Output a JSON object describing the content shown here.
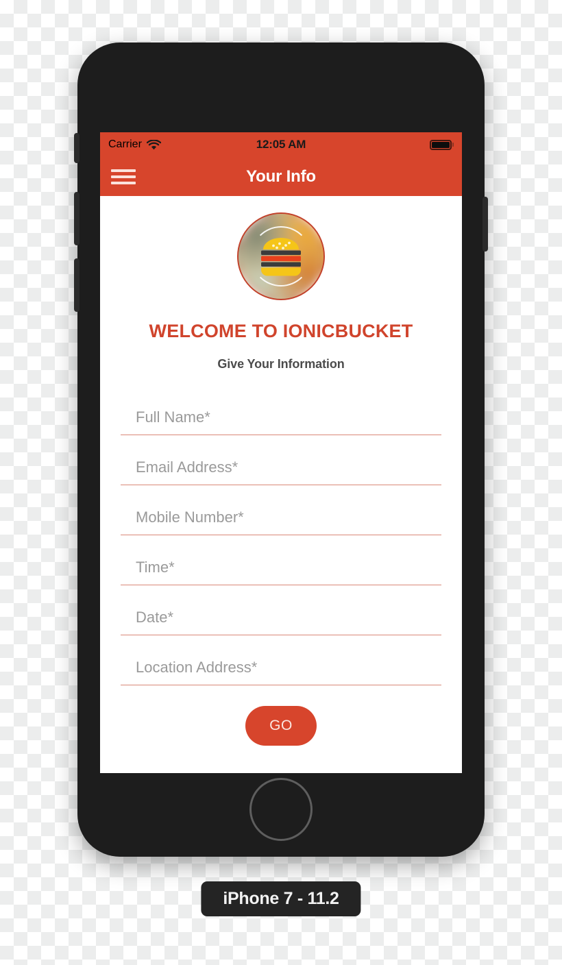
{
  "device": {
    "caption": "iPhone 7 - 11.2",
    "home_button_name": "home-button"
  },
  "status_bar": {
    "carrier": "Carrier",
    "wifi_icon": "wifi-icon",
    "time": "12:05 AM",
    "battery_icon": "battery-icon"
  },
  "nav_bar": {
    "menu_icon": "hamburger-menu-icon",
    "title": "Your Info"
  },
  "branding": {
    "logo_icon": "burger-logo-icon",
    "welcome_title": "WELCOME TO IONICBUCKET",
    "subtitle": "Give Your Information"
  },
  "form": {
    "fields": [
      {
        "name": "full-name",
        "placeholder": "Full Name*",
        "value": ""
      },
      {
        "name": "email-address",
        "placeholder": "Email Address*",
        "value": ""
      },
      {
        "name": "mobile-number",
        "placeholder": "Mobile Number*",
        "value": ""
      },
      {
        "name": "time",
        "placeholder": "Time*",
        "value": ""
      },
      {
        "name": "date",
        "placeholder": "Date*",
        "value": ""
      },
      {
        "name": "location-address",
        "placeholder": "Location Address*",
        "value": ""
      }
    ],
    "submit_label": "GO"
  },
  "colors": {
    "accent_red": "#d7452c",
    "title_red": "#d0442c",
    "underline": "#d98878",
    "subtitle_gray": "#4b4b4b",
    "placeholder_gray": "#9a9a9a",
    "phone_body": "#1d1d1d"
  }
}
